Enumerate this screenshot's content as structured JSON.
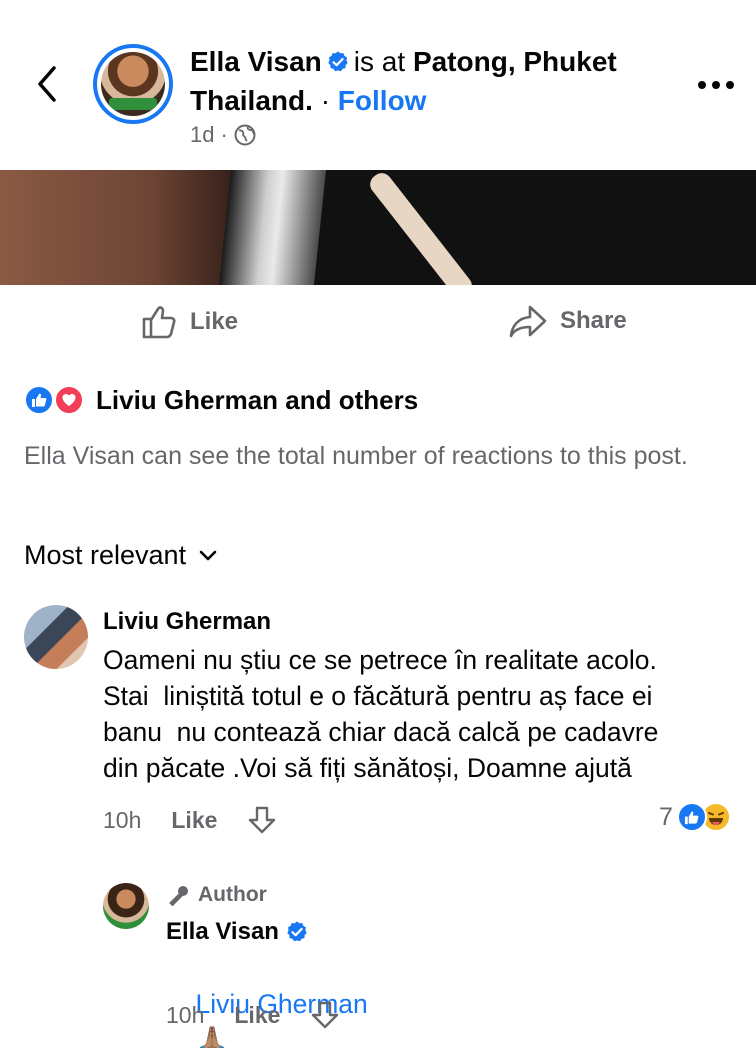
{
  "post": {
    "author": "Ella Visan",
    "checkin_prefix": "is at",
    "location": "Patong, Phuket Thailand.",
    "separator": "·",
    "follow_label": "Follow",
    "time": "1d",
    "time_dot": "·",
    "privacy_icon": "globe-icon"
  },
  "actions": {
    "like_label": "Like",
    "share_label": "Share"
  },
  "reactions": {
    "icons": [
      "like-reaction-icon",
      "love-reaction-icon"
    ],
    "summary": "Liviu Gherman and others",
    "note": "Ella Visan can see the total number of reactions to this post."
  },
  "sort": {
    "label": "Most relevant"
  },
  "comments": [
    {
      "author": "Liviu Gherman",
      "text": "Oameni nu știu ce se petrece în realitate acolo.\nStai  liniștită totul e o făcătură pentru aș face ei\nbanu  nu contează chiar dacă calcă pe cadavre\ndin păcate .Voi să fiți sănătoși, Doamne ajută",
      "time": "10h",
      "like_label": "Like",
      "reaction_count": "7",
      "reaction_icons": [
        "like-reaction-icon",
        "haha-reaction-icon"
      ]
    },
    {
      "badge": "Author",
      "author": "Ella Visan",
      "mention": "Liviu Gherman",
      "emoji": "🙏🏽",
      "time": "10h",
      "like_label": "Like"
    }
  ],
  "colors": {
    "accent": "#1877f2",
    "secondary_text": "#65676b",
    "love": "#f33e58",
    "haha": "#f7b928"
  }
}
